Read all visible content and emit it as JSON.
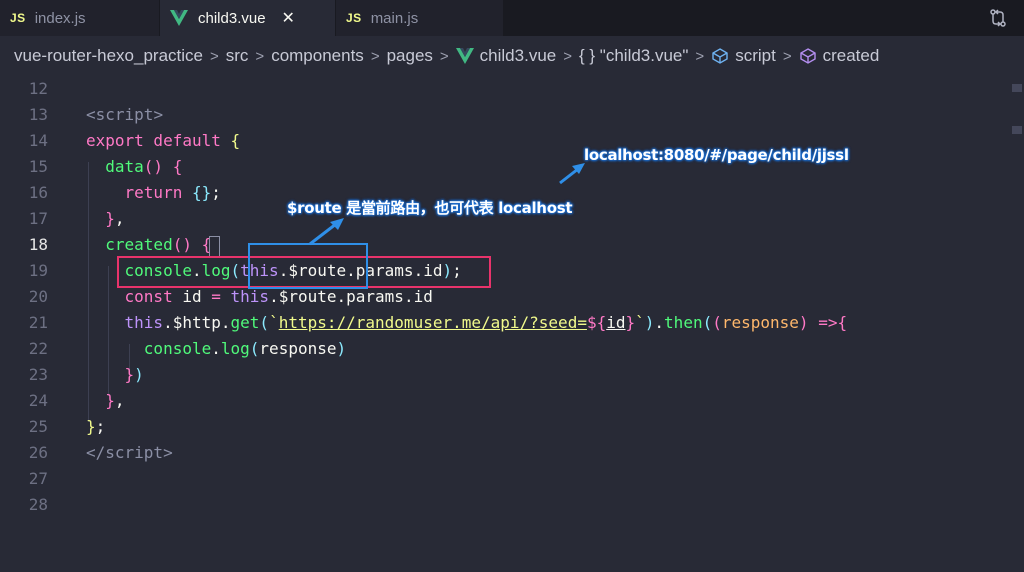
{
  "tabs": [
    {
      "icon": "js-icon",
      "badge": "JS",
      "label": "index.js",
      "active": false
    },
    {
      "icon": "vue-icon",
      "label": "child3.vue",
      "active": true,
      "close": "✕"
    },
    {
      "icon": "js-icon",
      "badge": "JS",
      "label": "main.js",
      "active": false
    }
  ],
  "breadcrumb": {
    "items": [
      "vue-router-hexo_practice",
      "src",
      "components",
      "pages",
      "child3.vue",
      "{ } \"child3.vue\"",
      "script",
      "created"
    ],
    "separator": ">"
  },
  "editor": {
    "line_numbers": [
      "12",
      "13",
      "14",
      "15",
      "16",
      "17",
      "18",
      "19",
      "20",
      "21",
      "22",
      "23",
      "24",
      "25",
      "26",
      "27",
      "28"
    ],
    "current_line": "18"
  },
  "annotations": {
    "route_note": "$route 是當前路由，也可代表 localhost",
    "url_note": "localhost:8080/#/page/child/jjssl"
  },
  "colors": {
    "accent_red": "#e8336b",
    "accent_blue": "#2f8fe8",
    "vue_green": "#41b883",
    "js_yellow": "#f1fa8c"
  }
}
